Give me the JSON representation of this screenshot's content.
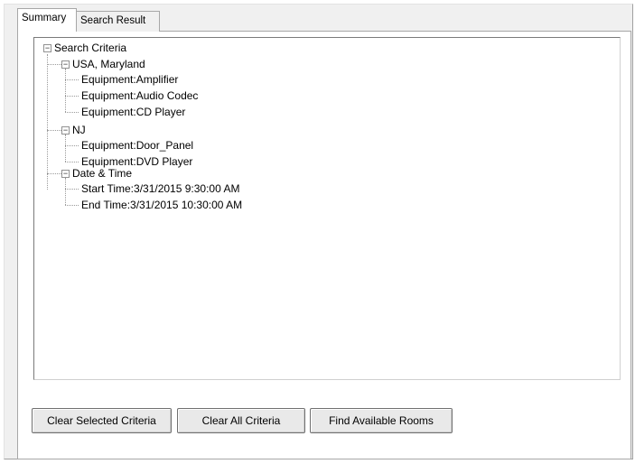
{
  "tabs": [
    {
      "label": "Summary",
      "active": true
    },
    {
      "label": "Search Result",
      "active": false
    }
  ],
  "tree": {
    "root": {
      "label": "Search Criteria",
      "expander": "−",
      "groups": [
        {
          "label": "USA, Maryland",
          "expander": "−",
          "items": [
            "Equipment:Amplifier",
            "Equipment:Audio Codec",
            "Equipment:CD Player"
          ]
        },
        {
          "label": "NJ",
          "expander": "−",
          "items": [
            "Equipment:Door_Panel",
            "Equipment:DVD Player"
          ]
        },
        {
          "label": "Date & Time",
          "expander": "−",
          "items": [
            "Start Time:3/31/2015 9:30:00 AM",
            "End Time:3/31/2015 10:30:00 AM"
          ]
        }
      ]
    }
  },
  "buttons": {
    "clear_selected": "Clear Selected Criteria",
    "clear_all": "Clear All Criteria",
    "find_rooms": "Find Available Rooms"
  }
}
